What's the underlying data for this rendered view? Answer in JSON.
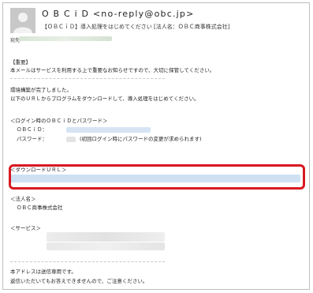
{
  "email": {
    "sender": "O B C i D <no-reply@obc.jp>",
    "subject": "【ＯＢＣｉＤ】導入処理をはじめてください [法人名：ＯＢＣ商事株式会社]",
    "to_label": "宛先"
  },
  "body": {
    "important_tag": "【重要】",
    "important_text": "本メールはサービスを利用する上で重要なお知らせですので、大切に保管してください。",
    "env_complete": "環境構築が完了しました。",
    "instruction": "以下のＵＲＬからプログラムをダウンロードして、導入処理をはじめてください。",
    "login_heading": "＜ログイン時のＯＢＣｉＤとパスワード＞",
    "obcid_label": "ＯＢＣｉＤ：",
    "password_label": "パスワード：",
    "password_note": "(初回ログイン時にパスワードの変更が求められます)",
    "download_heading": "＜ダウンロードＵＲＬ＞",
    "corp_heading": "＜法人名＞",
    "corp_name": "ＯＢＣ商事株式会社",
    "service_heading": "＜サービス＞",
    "footer_line1": "本アドレスは送信専用です。",
    "footer_line2": "返信いただいてもお答えできませんので、ご注意ください。"
  },
  "colors": {
    "highlight": "#d81921",
    "blur_blue": "#cfe0f2"
  }
}
